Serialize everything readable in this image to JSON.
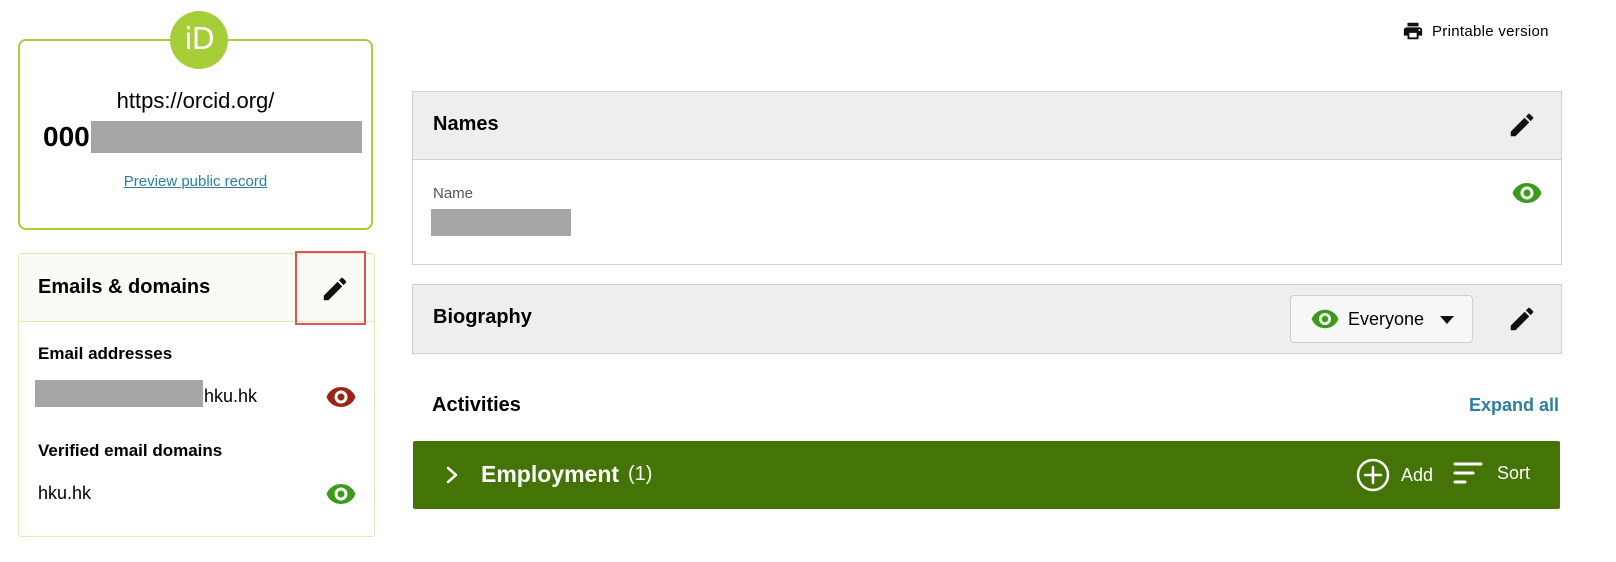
{
  "id_card": {
    "logo_text": "iD",
    "url": "https://orcid.org/",
    "id_prefix": "000",
    "preview_link": "Preview public record"
  },
  "emails": {
    "title": "Emails & domains",
    "addresses_heading": "Email addresses",
    "address_suffix": "hku.hk",
    "address_visibility": "private",
    "verified_heading": "Verified email domains",
    "verified_domain": "hku.hk",
    "verified_visibility": "everyone"
  },
  "toolbar": {
    "printable_label": "Printable version"
  },
  "names": {
    "title": "Names",
    "name_label": "Name",
    "visibility": "everyone"
  },
  "biography": {
    "title": "Biography",
    "visibility_selected": "Everyone"
  },
  "activities": {
    "title": "Activities",
    "expand_all": "Expand all",
    "employment": {
      "title": "Employment",
      "count": "(1)",
      "add_label": "Add",
      "sort_label": "Sort"
    }
  },
  "colors": {
    "orcid_green": "#a6ce39",
    "employment_green": "#447405",
    "link_blue": "#2e7f9f",
    "eye_public": "#3d9b1b",
    "eye_private": "#9b2416",
    "highlight_red": "#e05252"
  },
  "icons": [
    "orcid-logo",
    "printer-icon",
    "pencil-icon",
    "eye-icon",
    "caret-down-icon",
    "chevron-right-icon",
    "add-circle-icon",
    "sort-icon"
  ]
}
